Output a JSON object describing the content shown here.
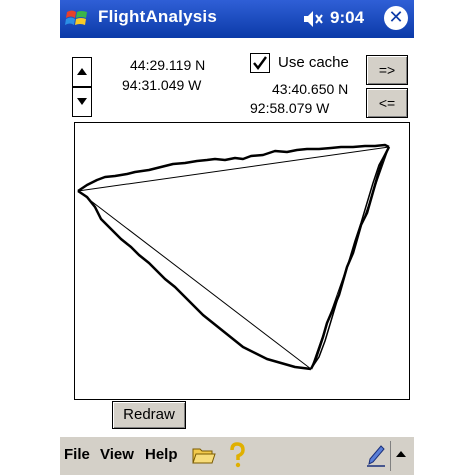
{
  "titlebar": {
    "app_title": "FlightAnalysis",
    "time": "9:04",
    "close_glyph": "✕"
  },
  "coords": {
    "start_lat": "44:29.119 N",
    "start_lon": "94:31.049 W",
    "end_lat": "43:40.650 N",
    "end_lon": "92:58.079 W"
  },
  "controls": {
    "use_cache_label": "Use cache",
    "use_cache_checked": true,
    "forward_label": "=>",
    "back_label": "<=",
    "redraw_label": "Redraw"
  },
  "menu": {
    "file": "File",
    "view": "View",
    "help": "Help"
  },
  "icons": [
    "windows-start-icon",
    "speaker-icon",
    "close-icon",
    "spin-up-icon",
    "spin-down-icon",
    "checkmark-icon",
    "folder-icon",
    "help-icon",
    "pen-icon",
    "sip-arrow-icon"
  ],
  "colors": {
    "titlebar": "#0b3aa8",
    "menubar": "#d4d0c8",
    "track": "#000000"
  }
}
